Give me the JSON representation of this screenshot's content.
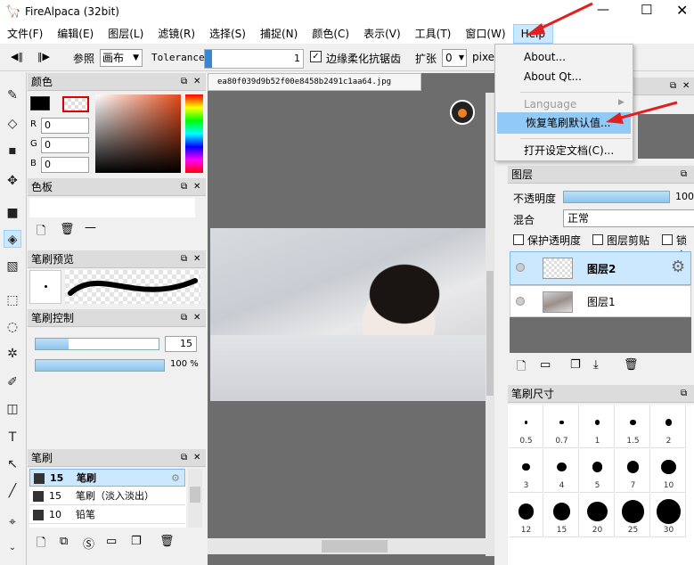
{
  "window": {
    "title": "FireAlpaca (32bit)"
  },
  "menu": [
    "文件(F)",
    "编辑(E)",
    "图层(L)",
    "滤镜(R)",
    "选择(S)",
    "捕捉(N)",
    "颜色(C)",
    "表示(V)",
    "工具(T)",
    "窗口(W)",
    "Help"
  ],
  "toolbar": {
    "ref_label": "参照",
    "ref_value": "画布",
    "tolerance_label": "Tolerance",
    "tolerance_value": "1",
    "antialias_label": "边缘柔化抗锯齿",
    "expand_label": "扩张",
    "expand_value": "0",
    "unit": "pixe"
  },
  "color_panel": {
    "title": "颜色",
    "r_label": "R",
    "g_label": "G",
    "b_label": "B",
    "r": "0",
    "g": "0",
    "b": "0"
  },
  "palette_panel": {
    "title": "色板"
  },
  "brush_preview_panel": {
    "title": "笔刷预览"
  },
  "brush_control_panel": {
    "title": "笔刷控制",
    "size": "15",
    "opacity": "100 %",
    "size_fraction": 0.27,
    "opacity_fraction": 1.0
  },
  "brush_panel": {
    "title": "笔刷",
    "items": [
      {
        "size": "15",
        "name": "笔刷"
      },
      {
        "size": "15",
        "name": "笔刷（淡入淡出）"
      },
      {
        "size": "10",
        "name": "铅笔"
      }
    ]
  },
  "canvas": {
    "tab": "ea80f039d9b52f00e8458b2491c1aa64.jpg"
  },
  "help_menu": {
    "items": [
      "About...",
      "About Qt...",
      "Language",
      "恢复笔刷默认值...",
      "打开设定文档(C)..."
    ]
  },
  "layer_panel": {
    "title": "图层",
    "opacity_label": "不透明度",
    "opacity_value": "100",
    "blend_label": "混合",
    "blend_value": "正常",
    "protect_label": "保护透明度",
    "clip_label": "图层剪贴",
    "lock_label": "锁定",
    "layers": [
      {
        "name": "图层2"
      },
      {
        "name": "图层1"
      }
    ]
  },
  "brush_size_panel": {
    "title": "笔刷尺寸",
    "sizes": [
      "0.5",
      "0.7",
      "1",
      "1.5",
      "2",
      "3",
      "4",
      "5",
      "7",
      "10",
      "12",
      "15",
      "20",
      "25",
      "30"
    ]
  },
  "colors": {
    "accent": "#cce8ff",
    "selection": "#99d1ff",
    "arrow": "#e02020",
    "canvas_bg": "#6d6d6d"
  }
}
